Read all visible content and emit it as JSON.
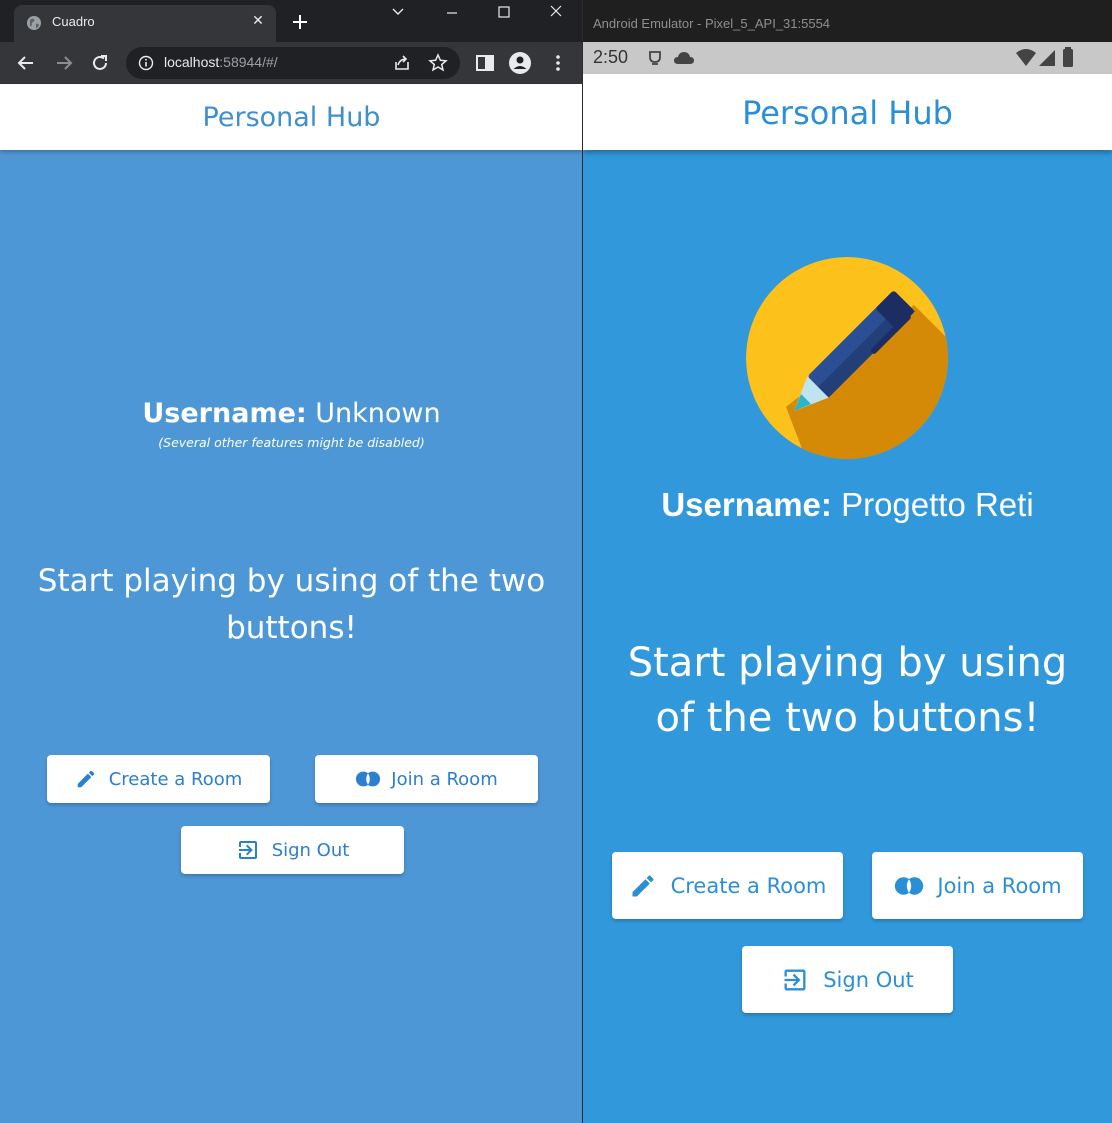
{
  "browser": {
    "tab_title": "Cuadro",
    "url_host": "localhost",
    "url_rest": ":58944/#/"
  },
  "web_app": {
    "title": "Personal Hub",
    "username_label": "Username:",
    "username_value": "Unknown",
    "note": "(Several other features might be disabled)",
    "cta": "Start playing by using of the two buttons!",
    "buttons": {
      "create": "Create a Room",
      "join": "Join a Room",
      "signout": "Sign Out"
    }
  },
  "emulator": {
    "window_title": "Android Emulator - Pixel_5_API_31:5554",
    "status_time": "2:50",
    "app": {
      "title": "Personal Hub",
      "username_label": "Username:",
      "username_value": "Progetto Reti",
      "cta": "Start playing by using of the two buttons!",
      "buttons": {
        "create": "Create a Room",
        "join": "Join a Room",
        "signout": "Sign Out"
      }
    }
  },
  "colors": {
    "web_background": "#4e97d6",
    "emulator_background": "#3199db",
    "accent": "#2b7fcf",
    "avatar_circle": "#fcc11a"
  },
  "icons": {
    "create": "pencil-icon",
    "join": "join-circles-icon",
    "signout": "sign-out-icon",
    "avatar": "pen-avatar-icon"
  }
}
